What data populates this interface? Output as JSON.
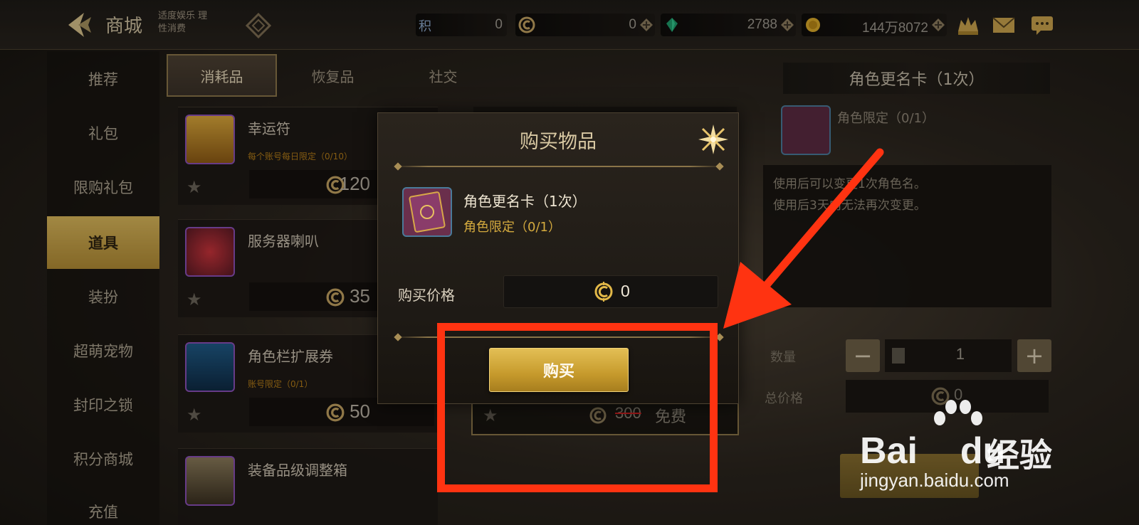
{
  "header": {
    "title": "商城",
    "health_tip": "适度娱乐 理性消费",
    "currencies": [
      {
        "icon": "points-icon",
        "value": "0",
        "label": "积"
      },
      {
        "icon": "c-coin-icon",
        "value": "0"
      },
      {
        "icon": "green-gem-icon",
        "value": "2788"
      },
      {
        "icon": "gold-coin-icon",
        "value": "144万8072"
      }
    ]
  },
  "nav": {
    "items": [
      "推荐",
      "礼包",
      "限购礼包",
      "道具",
      "装扮",
      "超萌宠物",
      "封印之锁",
      "积分商城",
      "充值"
    ],
    "active_index": 3
  },
  "tabs": {
    "items": [
      "消耗品",
      "恢复品",
      "社交"
    ],
    "active_index": 0
  },
  "items": [
    {
      "name": "幸运符",
      "limit": "每个账号每日限定（0/10）",
      "price": "120"
    },
    {
      "name": "服务器喇叭",
      "limit": "",
      "price": "35"
    },
    {
      "name": "角色栏扩展券",
      "limit": "账号限定（0/1）",
      "price": "50"
    },
    {
      "name": "装备品级调整箱",
      "limit": "",
      "price": ""
    }
  ],
  "middle": {
    "old_price": "300",
    "free_label": "免费"
  },
  "detail": {
    "title": "角色更名卡（1次）",
    "limit": "角色限定（0/1）",
    "desc_line1": "使用后可以变更1次角色名。",
    "desc_line2": "使用后3天内无法再次变更。",
    "qty_label": "数量",
    "qty_value": "1",
    "total_label": "总价格",
    "total_value": "0"
  },
  "modal": {
    "title": "购买物品",
    "item_name": "角色更名卡（1次）",
    "item_limit": "角色限定（0/1）",
    "price_label": "购买价格",
    "price_value": "0",
    "buy_label": "购买"
  },
  "watermark": {
    "brand": "Bai",
    "brand2": "du",
    "cn": "经验",
    "url": "jingyan.baidu.com"
  },
  "colors": {
    "accent_gold": "#c69a2c",
    "annotation_red": "#ff3311",
    "limit_gold": "#d4aa3e"
  }
}
